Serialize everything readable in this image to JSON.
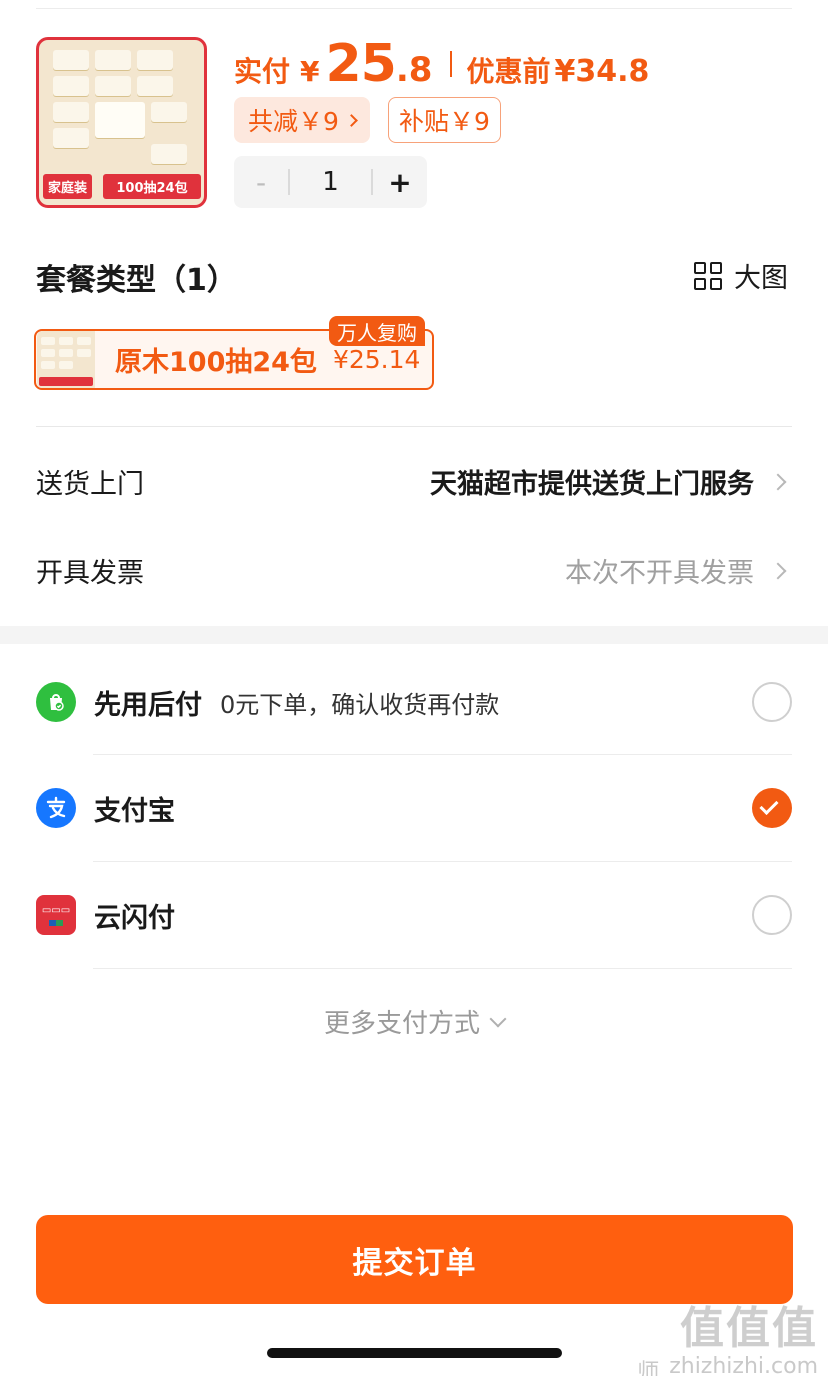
{
  "product": {
    "thumb_tag_left": "家庭装",
    "thumb_tag_right": "100抽24包",
    "pay_label": "实付",
    "currency": "¥",
    "amount_int": "25",
    "amount_dec": ".8",
    "before_label": "优惠前",
    "before_value": "¥34.8",
    "total_discount": "共减￥9",
    "subsidy": "补贴￥9",
    "quantity": "1",
    "minus": "-",
    "plus": "+"
  },
  "package": {
    "title": "套餐类型（1）",
    "big_view": "大图",
    "option_name": "原木100抽24包",
    "option_price": "¥25.14",
    "badge": "万人复购"
  },
  "delivery": {
    "label": "送货上门",
    "value": "天猫超市提供送货上门服务"
  },
  "invoice": {
    "label": "开具发票",
    "value": "本次不开具发票"
  },
  "payment": {
    "methods": [
      {
        "name": "先用后付",
        "desc": "0元下单，确认收货再付款",
        "selected": false
      },
      {
        "name": "支付宝",
        "desc": "",
        "selected": true
      },
      {
        "name": "云闪付",
        "desc": "",
        "selected": false
      }
    ],
    "more": "更多支付方式"
  },
  "submit_label": "提交订单",
  "colors": {
    "accent": "#f25a12",
    "submit": "#ff5f0f",
    "alipay": "#1677ff",
    "later_pay": "#2fbf3f",
    "unionpay": "#e0323c"
  },
  "watermark": {
    "text": "值值值",
    "sub_left": "师",
    "sub_right": "zhizhizhi.com"
  }
}
